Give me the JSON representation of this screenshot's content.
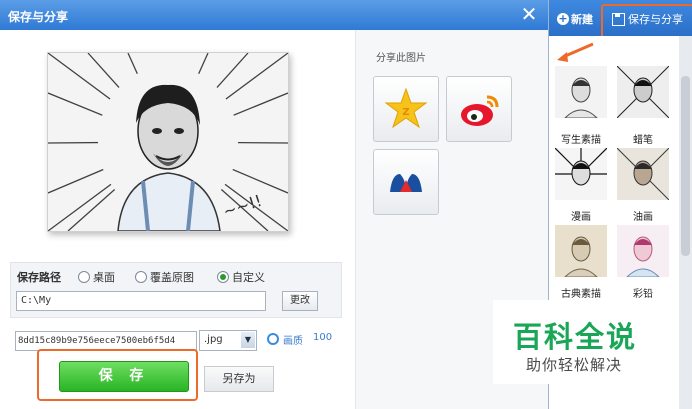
{
  "dialog": {
    "title": "保存与分享",
    "close_glyph": "✕"
  },
  "save_settings": {
    "path_label": "保存路径",
    "options": [
      "桌面",
      "覆盖原图",
      "自定义"
    ],
    "selected_option": "自定义",
    "path_value": "C:\\My",
    "change_button": "更改",
    "filename_value": "8dd15c89b9e756eece7500eb6f5d4",
    "format_value": ".jpg",
    "quality_label": "画质",
    "quality_value": "100",
    "save_button": "保 存",
    "save_as_button": "另存为"
  },
  "share": {
    "title": "分享此图片",
    "targets": [
      "qzone-icon",
      "weibo-icon",
      "renren-icon"
    ]
  },
  "right_panel": {
    "new_button": "新建",
    "save_share_button": "保存与分享",
    "thumbnails": [
      "写生素描",
      "蜡笔",
      "漫画",
      "油画",
      "古典素描",
      "彩铅"
    ]
  },
  "watermark": {
    "title": "百科全说",
    "subtitle": "助你轻松解决"
  },
  "colors": {
    "accent_blue": "#2f7ad5",
    "highlight_orange": "#ee6a2a",
    "save_green": "#29b424",
    "watermark_green": "#1aa657"
  }
}
